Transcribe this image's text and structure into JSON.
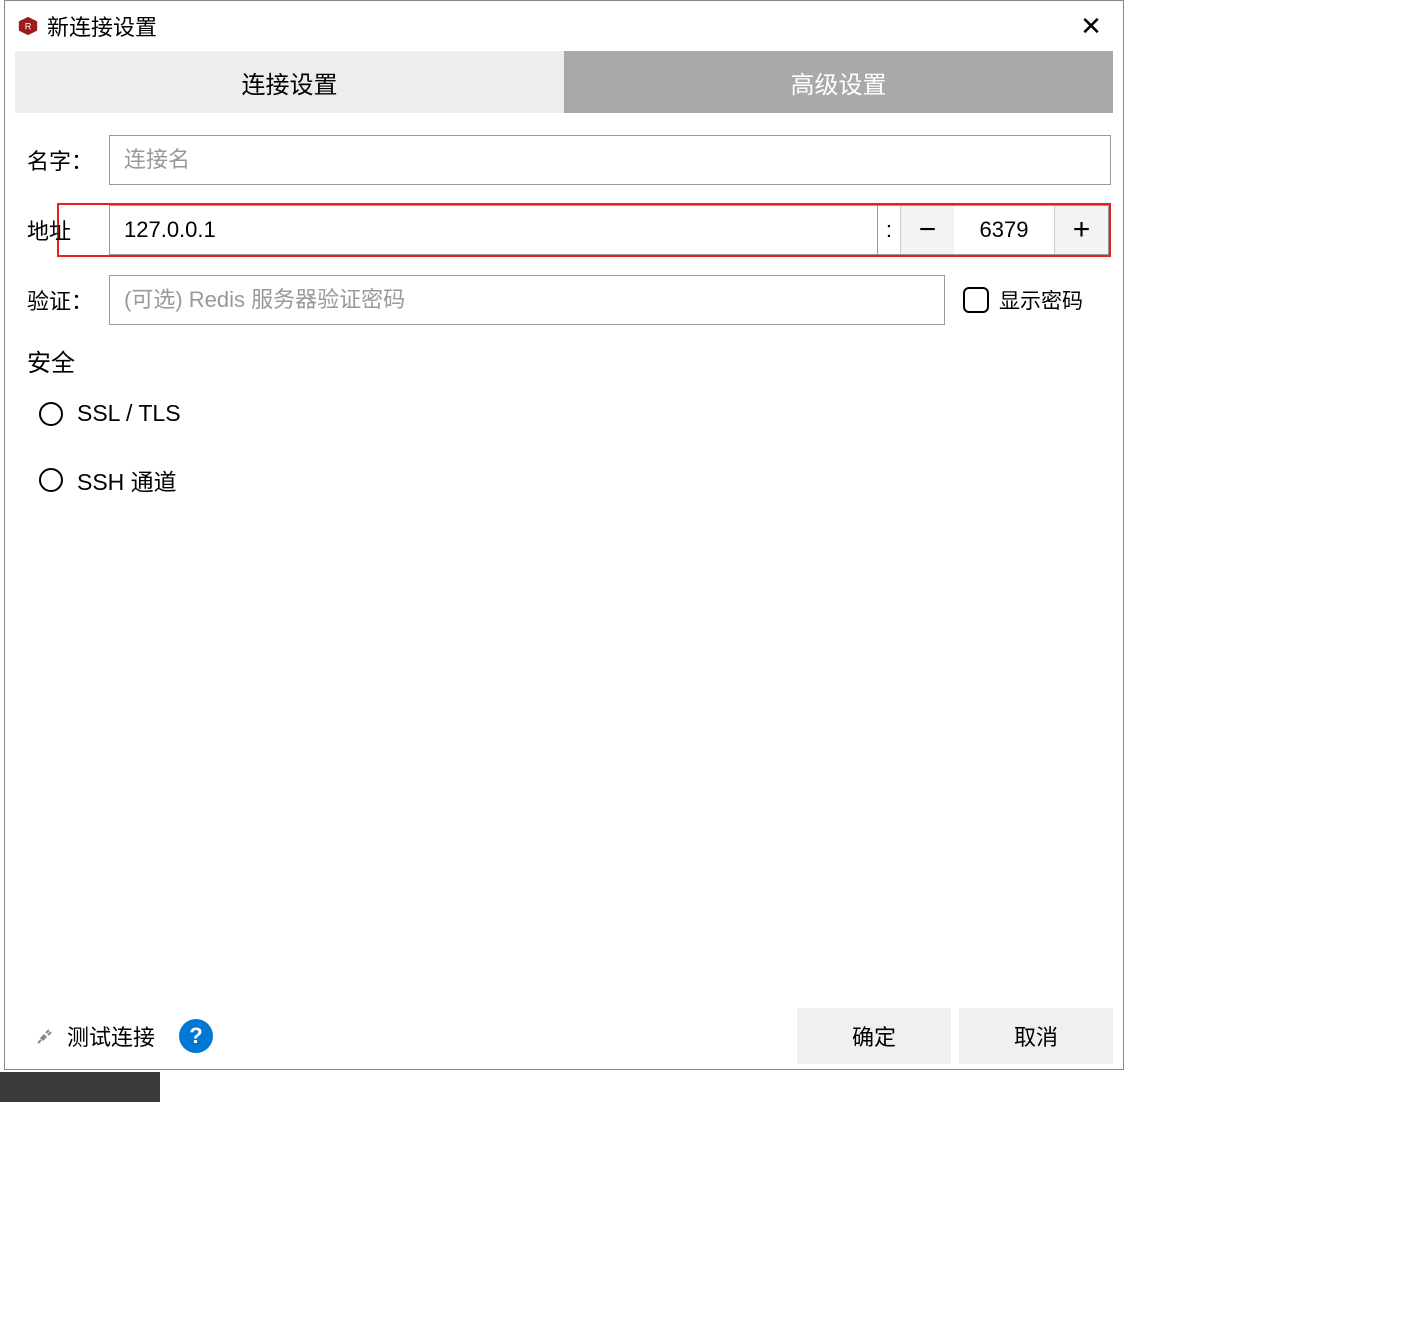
{
  "window": {
    "title": "新连接设置"
  },
  "tabs": {
    "connection": "连接设置",
    "advanced": "高级设置"
  },
  "form": {
    "name_label": "名字：",
    "name_placeholder": "连接名",
    "addr_label": "地址",
    "host_value": "127.0.0.1",
    "colon": ":",
    "port_value": "6379",
    "auth_label": "验证：",
    "auth_placeholder": "(可选) Redis 服务器验证密码",
    "showpw_label": "显示密码"
  },
  "security": {
    "heading": "安全",
    "ssl_label": "SSL / TLS",
    "ssh_label": "SSH 通道"
  },
  "footer": {
    "test_label": "测试连接",
    "help_char": "?",
    "ok_label": "确定",
    "cancel_label": "取消"
  },
  "icons": {
    "minus": "−",
    "plus": "+",
    "close": "✕"
  }
}
